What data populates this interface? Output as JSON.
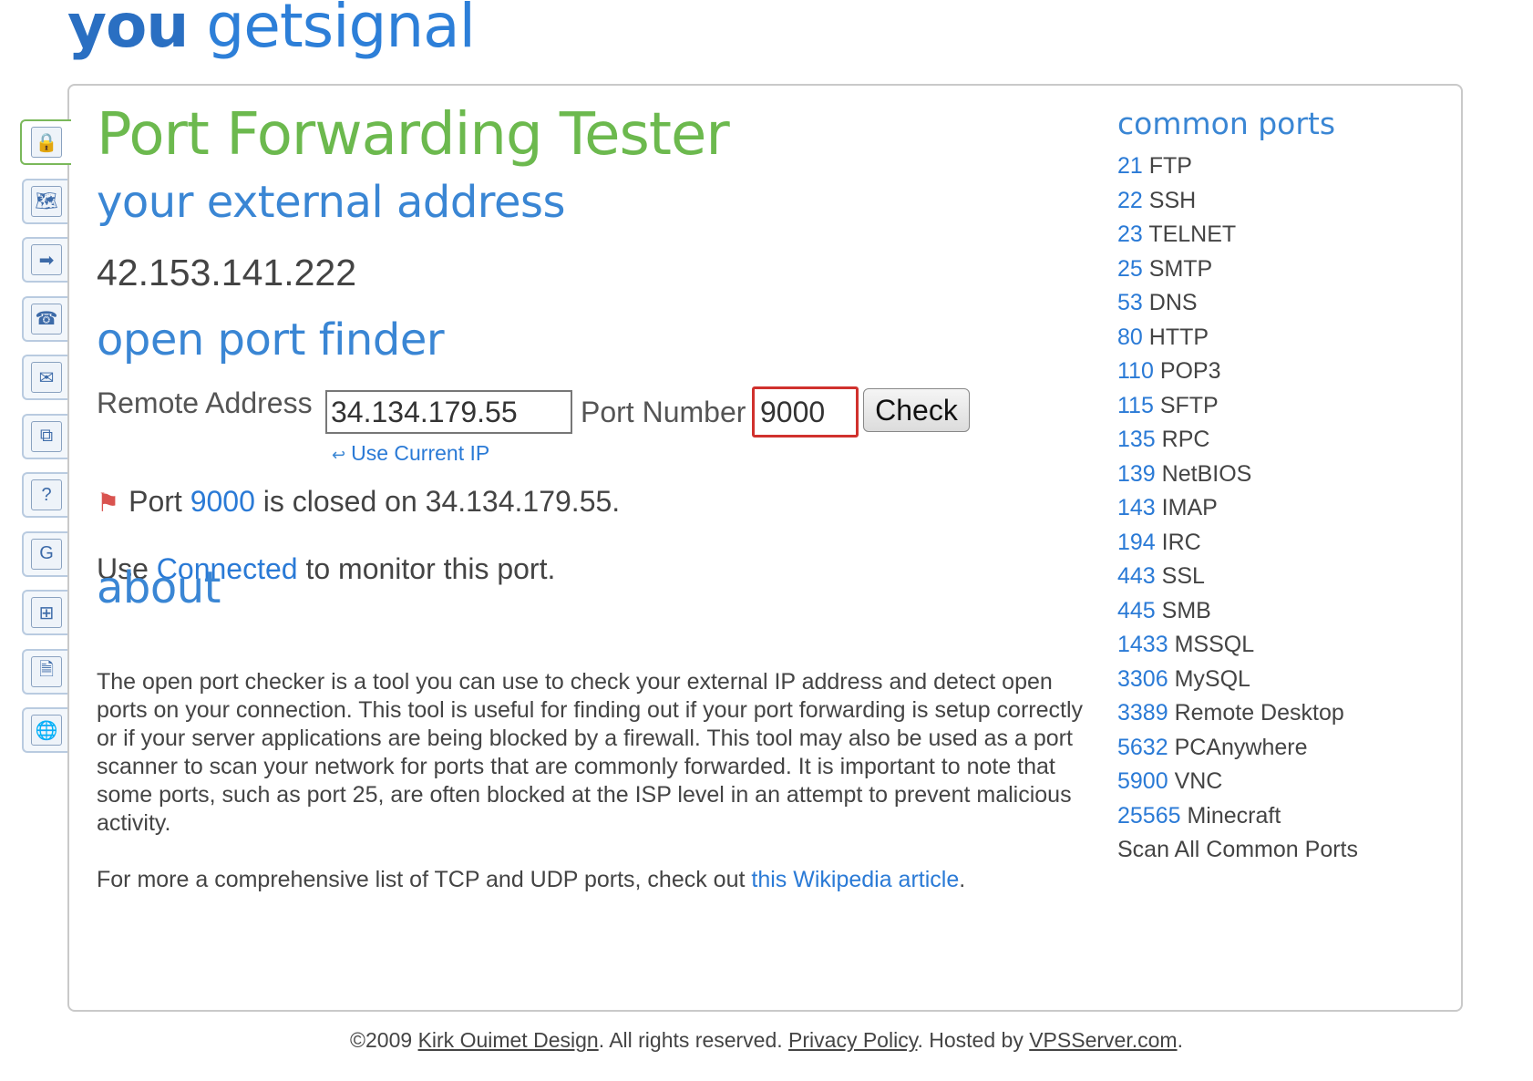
{
  "logo": {
    "word1": "you",
    "word2": "get",
    "word3": "signal"
  },
  "side_tabs": [
    {
      "name": "lock-icon",
      "glyph": "🔒"
    },
    {
      "name": "map-icon",
      "glyph": "🗺"
    },
    {
      "name": "map-arrow-icon",
      "glyph": "➡"
    },
    {
      "name": "phone-icon",
      "glyph": "☎"
    },
    {
      "name": "email-icon",
      "glyph": "✉"
    },
    {
      "name": "network-icon",
      "glyph": "⧉"
    },
    {
      "name": "help-icon",
      "glyph": "?"
    },
    {
      "name": "google-icon",
      "glyph": "G"
    },
    {
      "name": "windows-icon",
      "glyph": "⊞"
    },
    {
      "name": "document-icon",
      "glyph": "🗎"
    },
    {
      "name": "globe-icon",
      "glyph": "🌐"
    }
  ],
  "page": {
    "title": "Port Forwarding Tester",
    "external_heading": "your external address",
    "external_ip": "42.153.141.222",
    "finder_heading": "open port finder",
    "about_heading": "about"
  },
  "form": {
    "remote_label": "Remote Address",
    "remote_value": "34.134.179.55",
    "port_label": "Port Number",
    "port_value": "9000",
    "check_label": "Check",
    "use_current_ip": "Use Current IP"
  },
  "result": {
    "prefix": "Port",
    "port": "9000",
    "suffix": "is closed on 34.134.179.55."
  },
  "monitor": {
    "prefix": "Use",
    "link": "Connected",
    "suffix": "to monitor this port."
  },
  "about": {
    "text": "The open port checker is a tool you can use to check your external IP address and detect open ports on your connection. This tool is useful for finding out if your port forwarding is setup correctly or if your server applications are being blocked by a firewall. This tool may also be used as a port scanner to scan your network for ports that are commonly forwarded. It is important to note that some ports, such as port 25, are often blocked at the ISP level in an attempt to prevent malicious activity.",
    "more_prefix": "For more a comprehensive list of TCP and UDP ports, check out",
    "more_link": "this Wikipedia article",
    "more_suffix": "."
  },
  "common_ports": {
    "title": "common ports",
    "items": [
      {
        "port": "21",
        "name": "FTP"
      },
      {
        "port": "22",
        "name": "SSH"
      },
      {
        "port": "23",
        "name": "TELNET"
      },
      {
        "port": "25",
        "name": "SMTP"
      },
      {
        "port": "53",
        "name": "DNS"
      },
      {
        "port": "80",
        "name": "HTTP"
      },
      {
        "port": "110",
        "name": "POP3"
      },
      {
        "port": "115",
        "name": "SFTP"
      },
      {
        "port": "135",
        "name": "RPC"
      },
      {
        "port": "139",
        "name": "NetBIOS"
      },
      {
        "port": "143",
        "name": "IMAP"
      },
      {
        "port": "194",
        "name": "IRC"
      },
      {
        "port": "443",
        "name": "SSL"
      },
      {
        "port": "445",
        "name": "SMB"
      },
      {
        "port": "1433",
        "name": "MSSQL"
      },
      {
        "port": "3306",
        "name": "MySQL"
      },
      {
        "port": "3389",
        "name": "Remote Desktop"
      },
      {
        "port": "5632",
        "name": "PCAnywhere"
      },
      {
        "port": "5900",
        "name": "VNC"
      },
      {
        "port": "25565",
        "name": "Minecraft"
      }
    ],
    "scan_all": "Scan All Common Ports"
  },
  "footer": {
    "copyright": "©2009",
    "author_link": "Kirk Ouimet Design",
    "rights": ". All rights reserved.",
    "privacy_link": "Privacy Policy",
    "hosted": ". Hosted by",
    "host_link": "VPSServer.com",
    "end": "."
  }
}
